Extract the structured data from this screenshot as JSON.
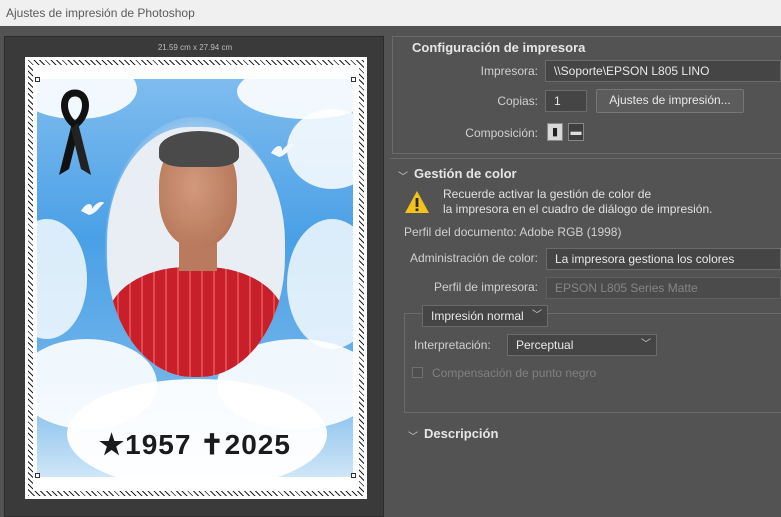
{
  "window": {
    "title": "Ajustes de impresión de Photoshop"
  },
  "preview": {
    "paper_size": "21.59 cm x 27.94 cm",
    "photo_years": "★1957   ✝2025"
  },
  "printer_config": {
    "title": "Configuración de impresora",
    "printer_label": "Impresora:",
    "printer_value": "\\\\Soporte\\EPSON L805 LINO",
    "copies_label": "Copias:",
    "copies_value": "1",
    "print_settings_button": "Ajustes de impresión...",
    "layout_label": "Composición:",
    "layout_icons": [
      "portrait-layout-icon",
      "landscape-layout-icon"
    ]
  },
  "color_management": {
    "title": "Gestión de color",
    "warning_text_1": "Recuerde activar la gestión de color de",
    "warning_text_2": "la impresora en el cuadro de diálogo de impresión.",
    "document_profile": "Perfil del documento: Adobe RGB (1998)",
    "color_handling_label": "Administración de color:",
    "color_handling_value": "La impresora gestiona los colores",
    "printer_profile_label": "Perfil de impresora:",
    "printer_profile_value": "EPSON L805 Series Matte",
    "print_mode_value": "Impresión normal",
    "rendering_label": "Interpretación:",
    "rendering_value": "Perceptual",
    "black_point_label": "Compensación de punto negro"
  },
  "description": {
    "title": "Descripción"
  },
  "colors": {
    "panel_bg": "#535353",
    "field_bg": "#454545",
    "warning": "#f3c21b"
  }
}
